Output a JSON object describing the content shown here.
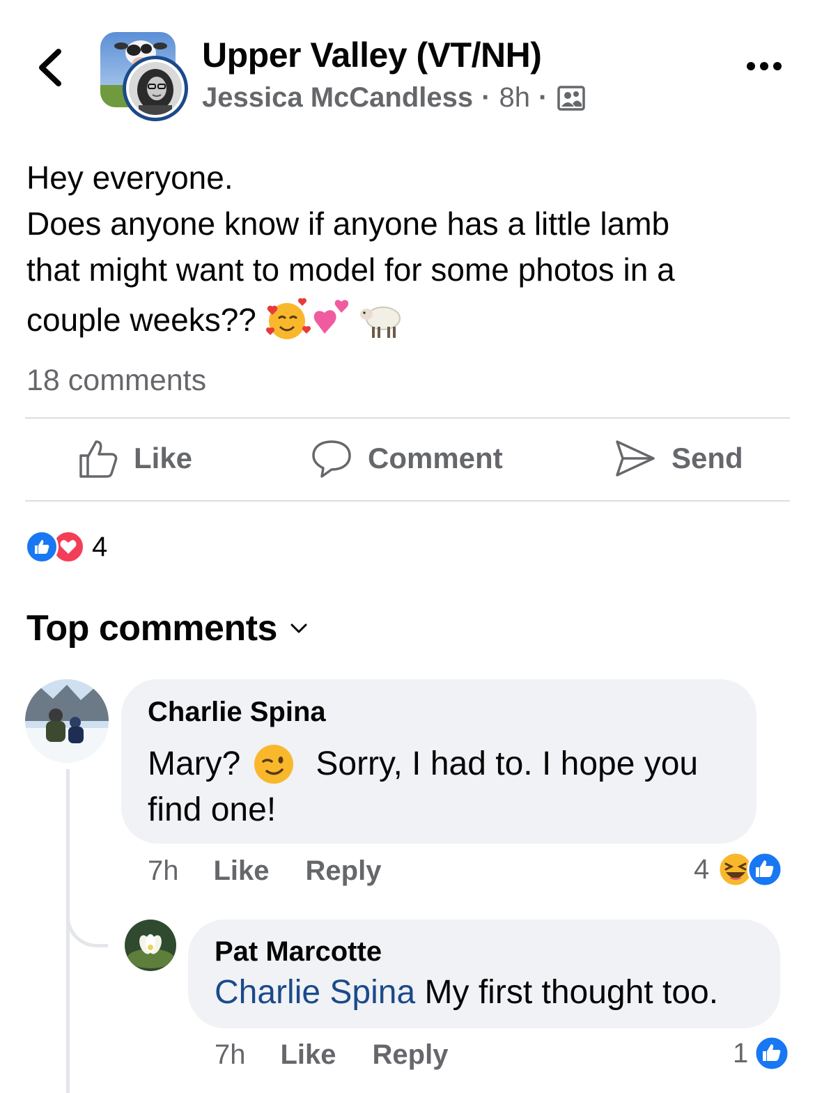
{
  "header": {
    "group_name": "Upper Valley (VT/NH)",
    "author": "Jessica McCandless",
    "separator": "·",
    "time": "8h",
    "back_icon": "chevron-left-icon",
    "more_icon": "more-horizontal-icon",
    "audience_icon": "group-members-icon"
  },
  "post": {
    "lines": [
      "Hey everyone.",
      "Does anyone know if anyone has a little lamb",
      "that might want to model for some photos in a",
      "couple weeks??"
    ],
    "emojis": [
      "smiling-face-with-hearts",
      "two-hearts",
      "sheep"
    ],
    "comments_count": "18 comments"
  },
  "actions": {
    "like": "Like",
    "comment": "Comment",
    "send": "Send"
  },
  "reactions": {
    "types": [
      "like",
      "love"
    ],
    "count": "4",
    "colors": {
      "like": "#1877f2",
      "love": "#f33e58"
    }
  },
  "top_comments": {
    "label": "Top comments"
  },
  "comments": [
    {
      "author": "Charlie Spina",
      "text_before": "Mary?",
      "emoji": "winking-face",
      "text_after": "Sorry, I had to.  I hope you",
      "text_line2": "find one!",
      "time": "7h",
      "like": "Like",
      "reply": "Reply",
      "reaction_count": "4",
      "reaction_types": [
        "haha",
        "like"
      ]
    },
    {
      "author": "Pat Marcotte",
      "mention": "Charlie Spina",
      "text": "My first thought too.",
      "time": "7h",
      "like": "Like",
      "reply": "Reply",
      "reaction_count": "1",
      "reaction_types": [
        "like"
      ]
    }
  ]
}
